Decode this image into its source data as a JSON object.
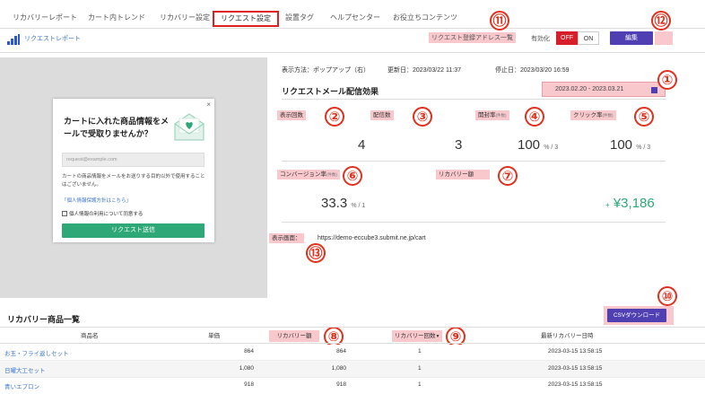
{
  "nav": {
    "items": [
      {
        "label": "リカバリーレポート"
      },
      {
        "label": "カート内トレンド"
      },
      {
        "label": "リカバリー設定"
      },
      {
        "label": "リクエスト設定"
      },
      {
        "label": "設置タグ"
      },
      {
        "label": "ヘルプセンター"
      },
      {
        "label": "お役立ちコンテンツ"
      }
    ]
  },
  "subheader": {
    "report_link": "リクエストレポート",
    "address_list_link": "リクエスト登録アドレス一覧",
    "enabled_label": "有効化",
    "toggle_off": "OFF",
    "toggle_on": "ON",
    "edit_button": "編集"
  },
  "popup": {
    "close": "×",
    "title": "カートに入れた商品情報をメールで受取りませんか？",
    "email_placeholder": "request@example.com",
    "description": "カートの商品情報をメールをお送りする目的以外で使用することはございません。",
    "privacy_link": "「個人情報保護方針はこちら」",
    "consent_label": "個人情報の利用について同意する",
    "submit": "リクエスト送信"
  },
  "details": {
    "display_method": "表示方法：ポップアップ（右）",
    "updated": "更新日：2023/03/22 11:37",
    "stopped": "停止日：2023/03/20 16:59",
    "section_title": "リクエストメール配信効果",
    "date_range": "2023.02.20 - 2023.03.21",
    "metrics": {
      "impressions_label": "表示回数",
      "impressions_value": "4",
      "sends_label": "配信数",
      "sends_value": "3",
      "open_label": "開封率",
      "open_hint": "(件数)",
      "open_value": "100",
      "open_unit": "% / 3",
      "click_label": "クリック率",
      "click_hint": "(件数)",
      "click_value": "100",
      "click_unit": "% / 3",
      "conversion_label": "コンバージョン率",
      "conversion_hint": "(件数)",
      "conversion_value": "33.3",
      "conversion_unit": "% / 1",
      "recovery_label": "リカバリー額",
      "recovery_plus": "+",
      "recovery_value": "¥3,186"
    },
    "display_page_label": "表示画面：",
    "display_page_url": "https://demo-eccube3.submit.ne.jp/cart"
  },
  "annotations": [
    "①",
    "②",
    "③",
    "④",
    "⑤",
    "⑥",
    "⑦",
    "⑧",
    "⑨",
    "⑩",
    "⑪",
    "⑫",
    "⑬"
  ],
  "table": {
    "title": "リカバリー商品一覧",
    "csv_button": "CSVダウンロード",
    "headers": [
      "商品名",
      "単価",
      "リカバリー額",
      "リカバリー回数",
      "最新リカバリー日時"
    ],
    "sort_indicator": "▼",
    "rows": [
      [
        "お玉・フライ返しセット",
        "864",
        "864",
        "1",
        "2023-03-15 13:58:15"
      ],
      [
        "日曜大工セット",
        "1,080",
        "1,080",
        "1",
        "2023-03-15 13:58:15"
      ],
      [
        "青いエプロン",
        "918",
        "918",
        "1",
        "2023-03-15 13:58:15"
      ]
    ]
  },
  "colors": {
    "accent_purple": "#4f3fb3",
    "toggle_red": "#d61f2a",
    "annotation_red": "#e0301e",
    "highlight_pink": "#f8c8cc",
    "submit_green": "#2ea877",
    "recovery_green": "#2ea877"
  }
}
